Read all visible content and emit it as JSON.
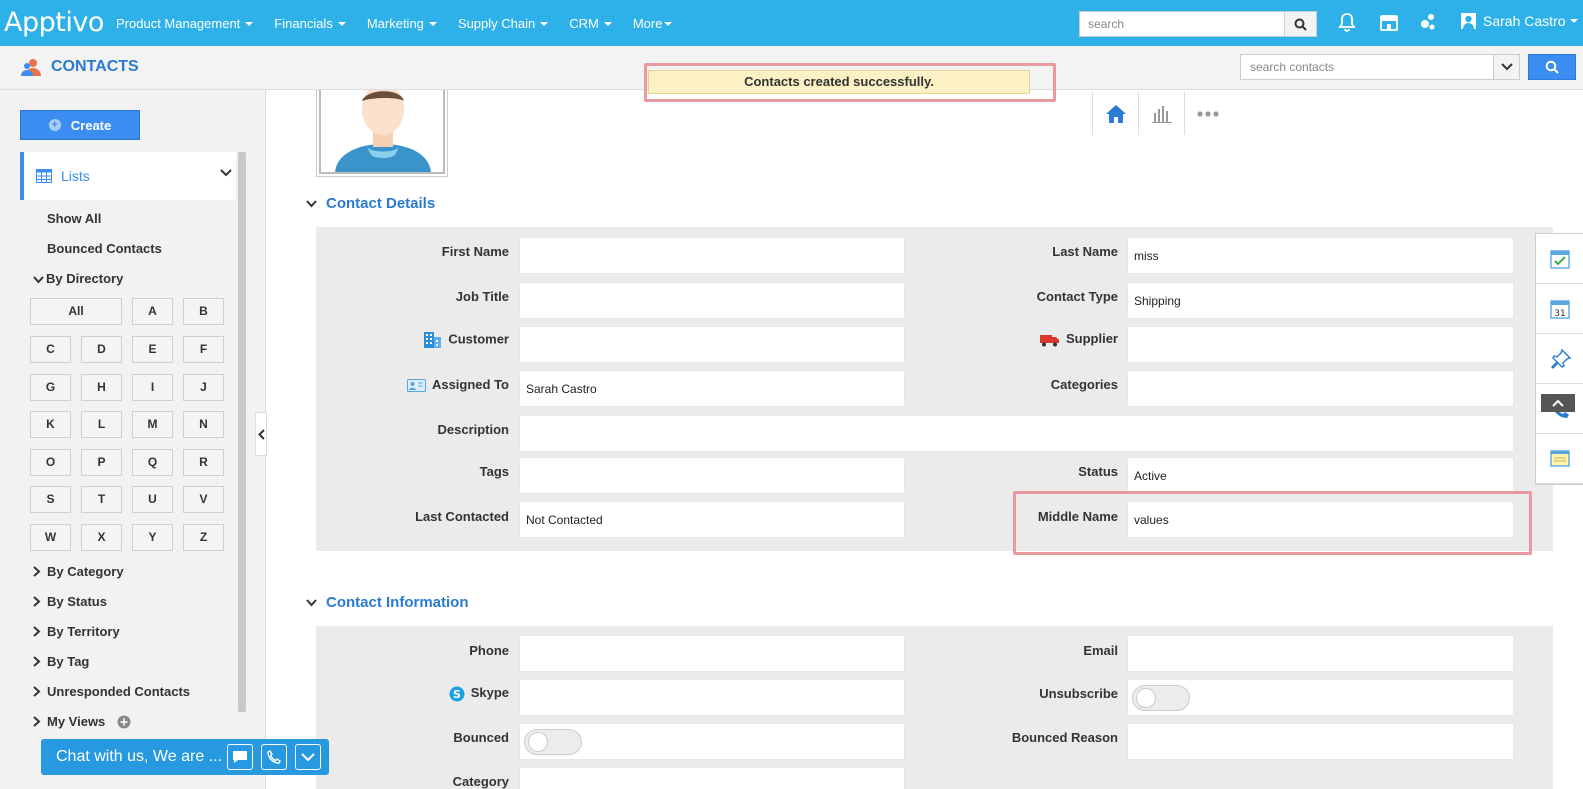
{
  "app": {
    "logo": "Apptivo",
    "user_name": "Sarah Castro"
  },
  "top_nav": [
    {
      "label": "Product Management"
    },
    {
      "label": "Financials"
    },
    {
      "label": "Marketing"
    },
    {
      "label": "Supply Chain"
    },
    {
      "label": "CRM"
    },
    {
      "label": "More"
    }
  ],
  "global_search": {
    "placeholder": "search"
  },
  "top_icons": [
    "search-icon",
    "bell-icon",
    "store-icon",
    "apps-icon",
    "user-avatar-icon"
  ],
  "module": {
    "title": "CONTACTS"
  },
  "toast": {
    "message": "Contacts created successfully."
  },
  "contact_search": {
    "placeholder": "search contacts"
  },
  "view_tabs": [
    "home-icon",
    "chart-icon",
    "more-dots-icon"
  ],
  "sidebar": {
    "create_label": "Create",
    "lists_label": "Lists",
    "show_all": "Show All",
    "bounced_contacts": "Bounced Contacts",
    "by_directory": "By Directory",
    "alphabet": [
      "All",
      "A",
      "B",
      "C",
      "D",
      "E",
      "F",
      "G",
      "H",
      "I",
      "J",
      "K",
      "L",
      "M",
      "N",
      "O",
      "P",
      "Q",
      "R",
      "S",
      "T",
      "U",
      "V",
      "W",
      "X",
      "Y",
      "Z"
    ],
    "groups": [
      "By Category",
      "By Status",
      "By Territory",
      "By Tag",
      "Unresponded Contacts",
      "My Views"
    ]
  },
  "chat": {
    "label": "Chat with us, We are ..."
  },
  "contact_details": {
    "title": "Contact Details",
    "first_name_label": "First Name",
    "first_name": "",
    "last_name_label": "Last Name",
    "last_name": "miss",
    "job_title_label": "Job Title",
    "job_title": "",
    "contact_type_label": "Contact Type",
    "contact_type": "Shipping",
    "customer_label": "Customer",
    "customer": "",
    "supplier_label": "Supplier",
    "supplier": "",
    "assigned_to_label": "Assigned To",
    "assigned_to": "Sarah Castro",
    "categories_label": "Categories",
    "categories": "",
    "description_label": "Description",
    "description": "",
    "tags_label": "Tags",
    "tags": "",
    "status_label": "Status",
    "status": "Active",
    "last_contacted_label": "Last Contacted",
    "last_contacted": "Not Contacted",
    "middle_name_label": "Middle Name",
    "middle_name": "values"
  },
  "contact_information": {
    "title": "Contact Information",
    "phone_label": "Phone",
    "phone": "",
    "email_label": "Email",
    "email": "",
    "skype_label": "Skype",
    "skype": "",
    "unsubscribe_label": "Unsubscribe",
    "unsubscribe": false,
    "bounced_label": "Bounced",
    "bounced": false,
    "bounced_reason_label": "Bounced Reason",
    "bounced_reason": "",
    "category_label": "Category"
  },
  "right_tools": [
    "task-icon",
    "calendar-icon",
    "pin-icon",
    "phone-icon",
    "note-icon"
  ]
}
